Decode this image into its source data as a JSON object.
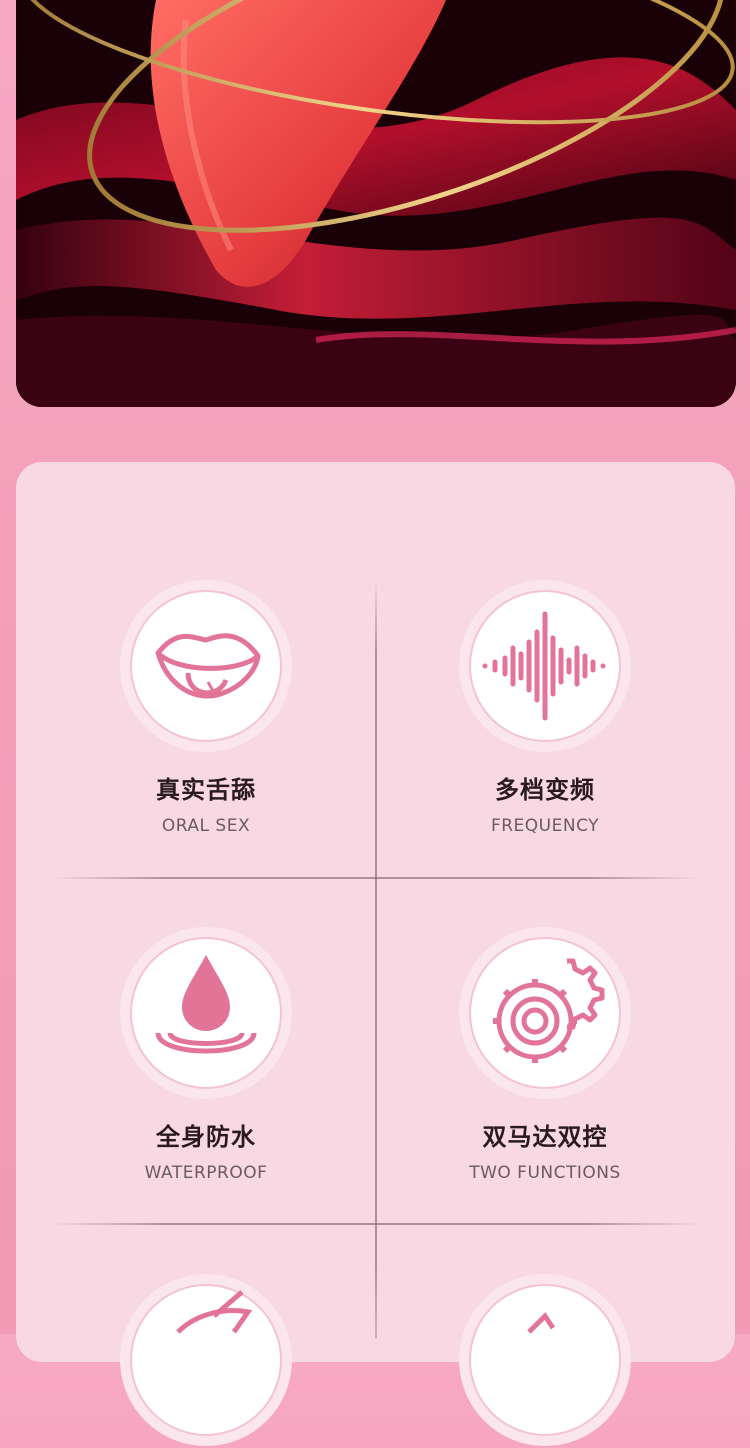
{
  "hero": {
    "image_name": "product-hero-image"
  },
  "features": [
    {
      "icon": "lips-icon",
      "title_zh": "真实舌舔",
      "title_en": "ORAL SEX"
    },
    {
      "icon": "sound-wave-icon",
      "title_zh": "多档变频",
      "title_en": "FREQUENCY"
    },
    {
      "icon": "water-drop-icon",
      "title_zh": "全身防水",
      "title_en": "WATERPROOF"
    },
    {
      "icon": "gears-icon",
      "title_zh": "双马达双控",
      "title_en": "TWO FUNCTIONS"
    }
  ],
  "colors": {
    "accent": "#e27497",
    "card_bg": "#f8d9e3",
    "page_bg": "#f4a0bb"
  }
}
